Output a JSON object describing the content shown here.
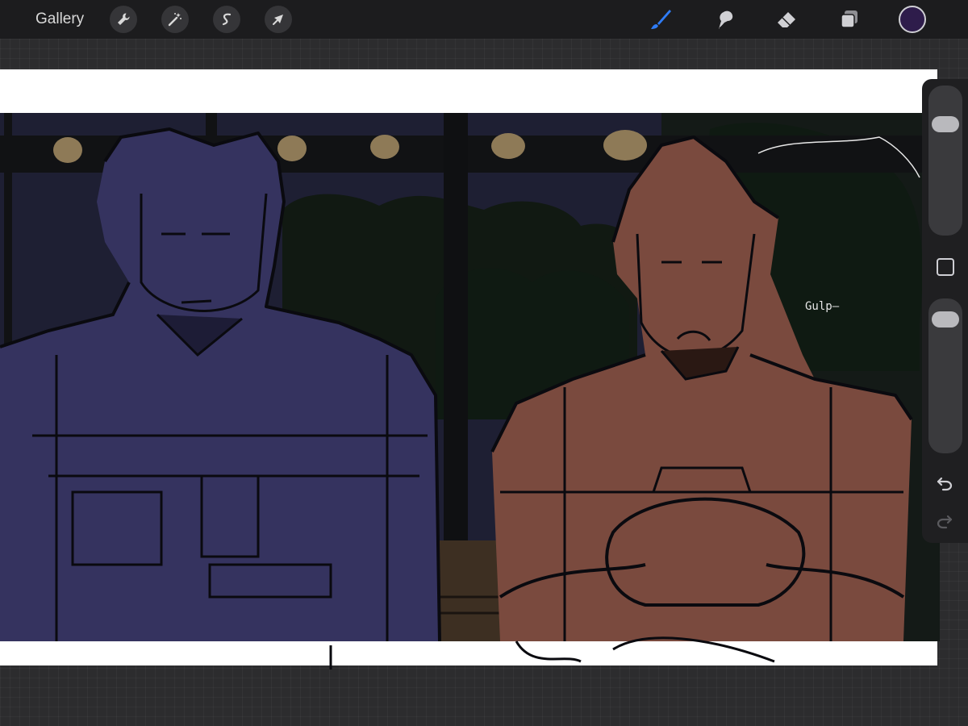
{
  "toolbar": {
    "gallery_label": "Gallery",
    "actions": [
      {
        "name": "actions-wrench-icon"
      },
      {
        "name": "adjustments-wand-icon"
      },
      {
        "name": "selection-s-icon"
      },
      {
        "name": "transform-arrow-icon"
      }
    ],
    "tools": [
      {
        "name": "brush-icon",
        "active": true
      },
      {
        "name": "smudge-icon",
        "active": false
      },
      {
        "name": "eraser-icon",
        "active": false
      },
      {
        "name": "layers-icon",
        "active": false
      }
    ],
    "current_color": "#2e1c4b"
  },
  "canvas": {
    "handwritten_text": "Gulp—"
  },
  "sidebar": {
    "brush_size_level": 0.2,
    "opacity_level": 0.05
  },
  "colors": {
    "accent": "#2f7cf6",
    "toolbar_bg": "#1c1c1e",
    "sky_dark": "#1e1f33",
    "left_figure_fill": "#35335f",
    "right_figure_fill": "#7a4a3e"
  }
}
